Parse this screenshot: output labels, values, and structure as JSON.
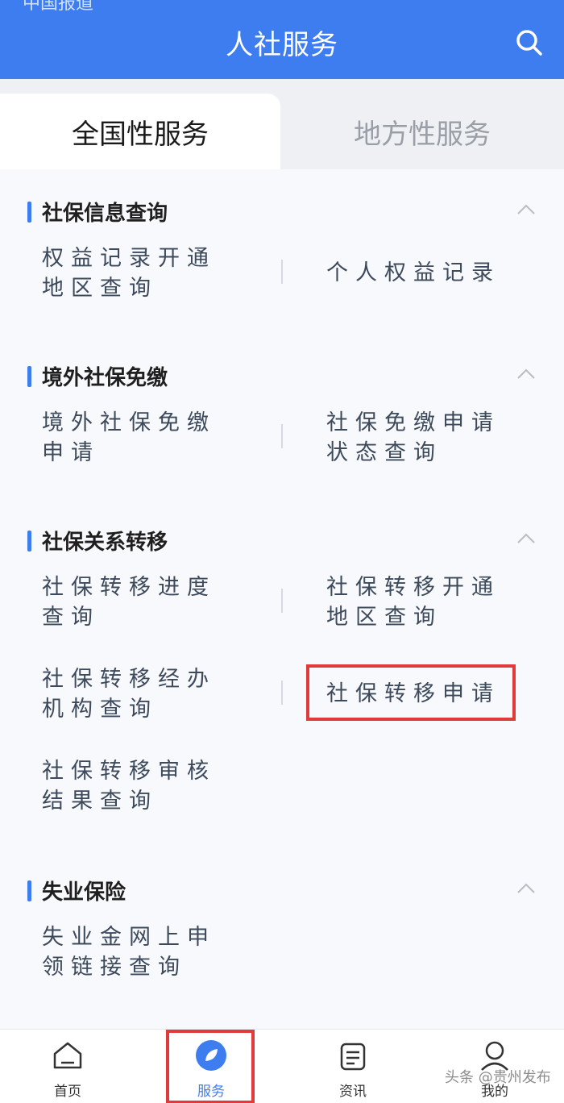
{
  "status_bar": {
    "partial_text": "中国报道"
  },
  "header": {
    "title": "人社服务",
    "search_icon": "search-icon"
  },
  "tabs": [
    {
      "label": "全国性服务",
      "active": true
    },
    {
      "label": "地方性服务",
      "active": false
    }
  ],
  "sections": [
    {
      "title": "社保信息查询",
      "items": [
        {
          "line1": "权益记录开通",
          "line2": "地区查询"
        },
        {
          "line1": "个人权益记录",
          "line2": ""
        }
      ]
    },
    {
      "title": "境外社保免缴",
      "items": [
        {
          "line1": "境外社保免缴",
          "line2": "申请"
        },
        {
          "line1": "社保免缴申请",
          "line2": "状态查询"
        }
      ]
    },
    {
      "title": "社保关系转移",
      "items": [
        {
          "line1": "社保转移进度",
          "line2": "查询"
        },
        {
          "line1": "社保转移开通",
          "line2": "地区查询"
        },
        {
          "line1": "社保转移经办",
          "line2": "机构查询"
        },
        {
          "line1": "社保转移申请",
          "line2": ""
        },
        {
          "line1": "社保转移审核",
          "line2": "结果查询"
        }
      ]
    },
    {
      "title": "失业保险",
      "items": [
        {
          "line1": "失业金网上申",
          "line2": "领链接查询"
        }
      ]
    }
  ],
  "bottom_nav": [
    {
      "label": "首页",
      "icon": "home-icon",
      "active": false
    },
    {
      "label": "服务",
      "icon": "compass-icon",
      "active": true
    },
    {
      "label": "资讯",
      "icon": "news-icon",
      "active": false
    },
    {
      "label": "我的",
      "icon": "user-icon",
      "active": false
    }
  ],
  "watermark": "头条 @贵州发布",
  "colors": {
    "primary": "#3d7df0",
    "highlight": "#e03a3a"
  }
}
